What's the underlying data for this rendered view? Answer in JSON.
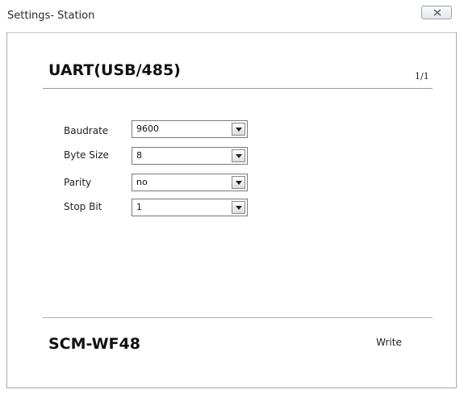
{
  "window": {
    "title": "Settings- Station"
  },
  "header": {
    "title": "UART(USB/485)",
    "page_indicator": "1/1"
  },
  "fields": [
    {
      "label": "Baudrate",
      "value": "9600"
    },
    {
      "label": "Byte Size",
      "value": "8"
    },
    {
      "label": "Parity",
      "value": "no"
    },
    {
      "label": "Stop Bit",
      "value": "1"
    }
  ],
  "footer": {
    "model": "SCM-WF48",
    "write_label": "Write"
  },
  "icons": {
    "close": "close-icon",
    "dropdown": "chevron-down-icon"
  }
}
